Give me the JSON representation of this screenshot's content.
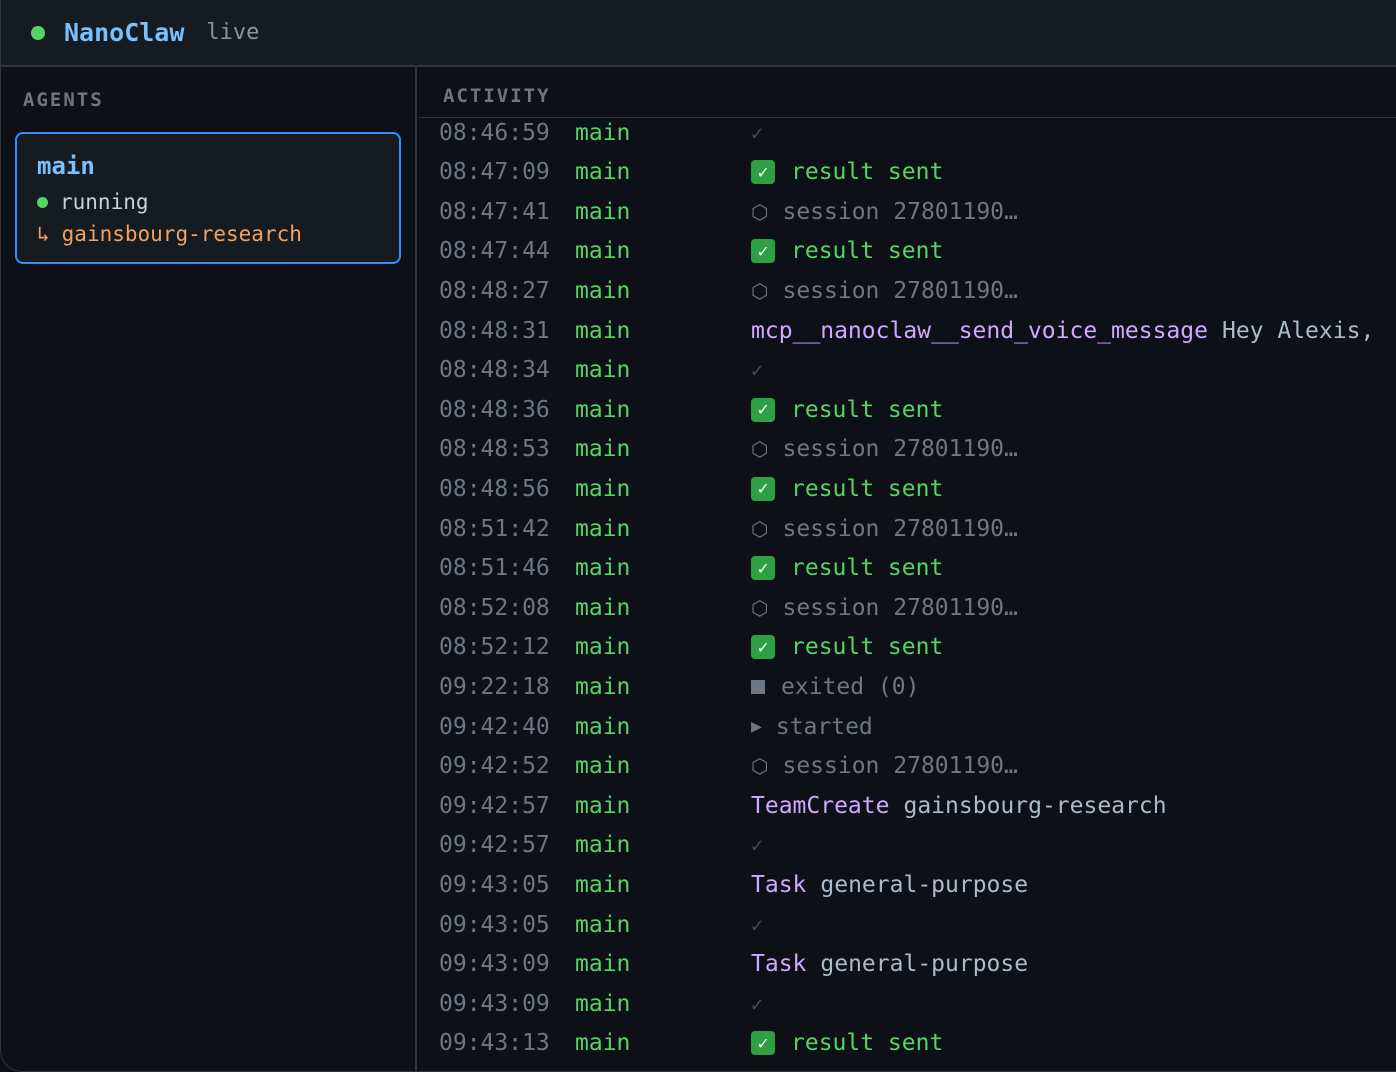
{
  "header": {
    "title": "NanoClaw",
    "status": "live"
  },
  "sidebar": {
    "title": "AGENTS",
    "agent": {
      "name": "main",
      "status": "running",
      "team_arrow": "↳",
      "team": "gainsbourg-research"
    }
  },
  "activity": {
    "title": "ACTIVITY",
    "rows": [
      {
        "time": "08:46:59",
        "agent": "main",
        "kind": "check",
        "text": ""
      },
      {
        "time": "08:47:09",
        "agent": "main",
        "kind": "result",
        "text": "result sent"
      },
      {
        "time": "08:47:41",
        "agent": "main",
        "kind": "session",
        "text": "session 27801190…"
      },
      {
        "time": "08:47:44",
        "agent": "main",
        "kind": "result",
        "text": "result sent"
      },
      {
        "time": "08:48:27",
        "agent": "main",
        "kind": "session",
        "text": "session 27801190…"
      },
      {
        "time": "08:48:31",
        "agent": "main",
        "kind": "tool",
        "tool": "mcp__nanoclaw__send_voice_message",
        "text": "Hey Alexis,"
      },
      {
        "time": "08:48:34",
        "agent": "main",
        "kind": "check",
        "text": ""
      },
      {
        "time": "08:48:36",
        "agent": "main",
        "kind": "result",
        "text": "result sent"
      },
      {
        "time": "08:48:53",
        "agent": "main",
        "kind": "session",
        "text": "session 27801190…"
      },
      {
        "time": "08:48:56",
        "agent": "main",
        "kind": "result",
        "text": "result sent"
      },
      {
        "time": "08:51:42",
        "agent": "main",
        "kind": "session",
        "text": "session 27801190…"
      },
      {
        "time": "08:51:46",
        "agent": "main",
        "kind": "result",
        "text": "result sent"
      },
      {
        "time": "08:52:08",
        "agent": "main",
        "kind": "session",
        "text": "session 27801190…"
      },
      {
        "time": "08:52:12",
        "agent": "main",
        "kind": "result",
        "text": "result sent"
      },
      {
        "time": "09:22:18",
        "agent": "main",
        "kind": "exited",
        "text": "exited (0)"
      },
      {
        "time": "09:42:40",
        "agent": "main",
        "kind": "started",
        "text": "started"
      },
      {
        "time": "09:42:52",
        "agent": "main",
        "kind": "session",
        "text": "session 27801190…"
      },
      {
        "time": "09:42:57",
        "agent": "main",
        "kind": "tool",
        "tool": "TeamCreate",
        "text": "gainsbourg-research"
      },
      {
        "time": "09:42:57",
        "agent": "main",
        "kind": "check",
        "text": ""
      },
      {
        "time": "09:43:05",
        "agent": "main",
        "kind": "tool",
        "tool": "Task",
        "text": "general-purpose"
      },
      {
        "time": "09:43:05",
        "agent": "main",
        "kind": "check",
        "text": ""
      },
      {
        "time": "09:43:09",
        "agent": "main",
        "kind": "tool",
        "tool": "Task",
        "text": "general-purpose"
      },
      {
        "time": "09:43:09",
        "agent": "main",
        "kind": "check",
        "text": ""
      },
      {
        "time": "09:43:13",
        "agent": "main",
        "kind": "result",
        "text": "result sent"
      }
    ]
  },
  "colors": {
    "accent": "#79c0ff",
    "running": "#56d364",
    "team": "#f0a35e",
    "tool": "#d2a8ff",
    "muted": "#6e7681"
  },
  "icons": {
    "check": "✓",
    "result": "✓",
    "session": "⬡",
    "started": "▶"
  }
}
